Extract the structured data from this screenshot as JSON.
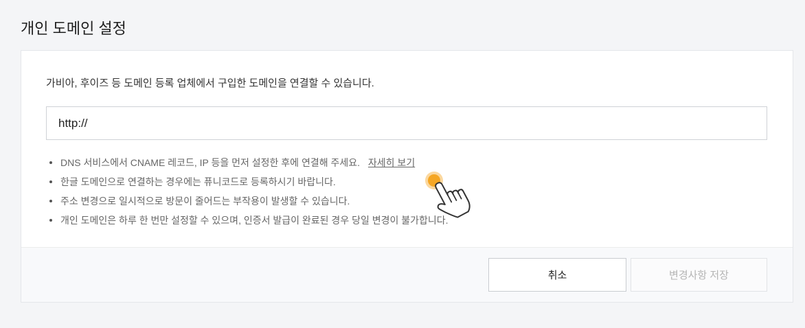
{
  "page": {
    "title": "개인 도메인 설정"
  },
  "card": {
    "description": "가비아, 후이즈 등 도메인 등록 업체에서 구입한 도메인을 연결할 수 있습니다.",
    "domain_input": {
      "value": "http://"
    },
    "notes": [
      {
        "text": "DNS 서비스에서 CNAME 레코드, IP 등을 먼저 설정한 후에 연결해 주세요.",
        "link_label": "자세히 보기"
      },
      {
        "text": "한글 도메인으로 연결하는 경우에는 퓨니코드로 등록하시기 바랍니다."
      },
      {
        "text": "주소 변경으로 일시적으로 방문이 줄어드는 부작용이 발생할 수 있습니다."
      },
      {
        "text": "개인 도메인은 하루 한 번만 설정할 수 있으며, 인증서 발급이 완료된 경우 당일 변경이 불가합니다."
      }
    ]
  },
  "footer": {
    "cancel_label": "취소",
    "save_label": "변경사항 저장",
    "save_disabled": true
  },
  "overlay": {
    "cursor_icon": "hand-pointer-icon",
    "click_marker": "click-indicator"
  },
  "colors": {
    "page_background": "#f4f5f7",
    "click_indicator": "#f5a623",
    "click_indicator_ring": "#fbd89f",
    "disabled_text": "#b4b4b4"
  }
}
